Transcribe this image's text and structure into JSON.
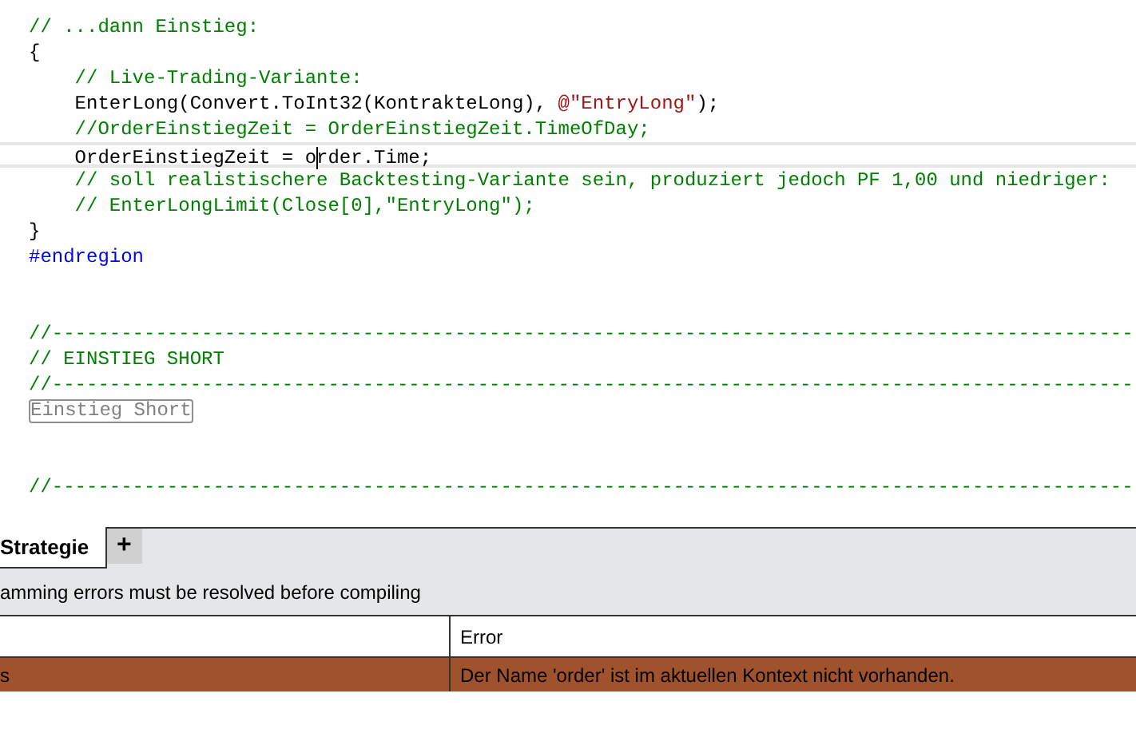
{
  "code_lines": [
    {
      "current": false,
      "tokens": [
        {
          "kind": "comment",
          "text": "// ...dann Einstieg:"
        }
      ]
    },
    {
      "current": false,
      "tokens": [
        {
          "kind": "plain",
          "text": "{"
        }
      ]
    },
    {
      "current": false,
      "tokens": [
        {
          "kind": "comment",
          "text": "    // Live-Trading-Variante:"
        }
      ]
    },
    {
      "current": false,
      "tokens": [
        {
          "kind": "plain",
          "text": "    EnterLong(Convert.ToInt32(KontrakteLong), "
        },
        {
          "kind": "string",
          "text": "@\"EntryLong\""
        },
        {
          "kind": "plain",
          "text": ");"
        }
      ]
    },
    {
      "current": false,
      "tokens": [
        {
          "kind": "comment",
          "text": "    //OrderEinstiegZeit = OrderEinstiegZeit.TimeOfDay;"
        }
      ]
    },
    {
      "current": true,
      "tokens": [
        {
          "kind": "plain",
          "text": "    OrderEinstiegZeit = o"
        },
        {
          "kind": "plain",
          "text": "rder.Time;",
          "caret_before": true
        }
      ]
    },
    {
      "current": false,
      "tokens": [
        {
          "kind": "comment",
          "text": "    // soll realistischere Backtesting-Variante sein, produziert jedoch PF 1,00 und niedriger:"
        }
      ]
    },
    {
      "current": false,
      "tokens": [
        {
          "kind": "comment",
          "text": "    // EnterLongLimit(Close[0],\"EntryLong\");"
        }
      ]
    },
    {
      "current": false,
      "tokens": [
        {
          "kind": "plain",
          "text": "}"
        }
      ]
    },
    {
      "current": false,
      "tokens": [
        {
          "kind": "keyword",
          "text": "#endregion"
        }
      ]
    },
    {
      "current": false
    },
    {
      "current": false
    },
    {
      "current": false,
      "tokens": [
        {
          "kind": "comment",
          "text": "//----------------------------------------------------------------------------------------------"
        }
      ]
    },
    {
      "current": false,
      "tokens": [
        {
          "kind": "comment",
          "text": "// EINSTIEG SHORT"
        }
      ]
    },
    {
      "current": false,
      "tokens": [
        {
          "kind": "comment",
          "text": "//----------------------------------------------------------------------------------------------"
        }
      ]
    },
    {
      "current": false,
      "tokens": [
        {
          "kind": "region",
          "text": "Einstieg Short"
        }
      ]
    },
    {
      "current": false
    },
    {
      "current": false
    },
    {
      "current": false,
      "tokens": [
        {
          "kind": "comment",
          "text": "//----------------------------------------------------------------------------------------------"
        }
      ]
    }
  ],
  "panel": {
    "tabs": [
      {
        "label": "Strategie",
        "selected": true
      }
    ],
    "add_tab": "+",
    "message": "amming errors must be resolved before compiling",
    "table": {
      "columns": [
        "",
        "Error"
      ],
      "rows": [
        {
          "cells": [
            "s",
            "Der Name 'order' ist im aktuellen Kontext nicht vorhanden."
          ],
          "selected": true
        }
      ]
    }
  }
}
